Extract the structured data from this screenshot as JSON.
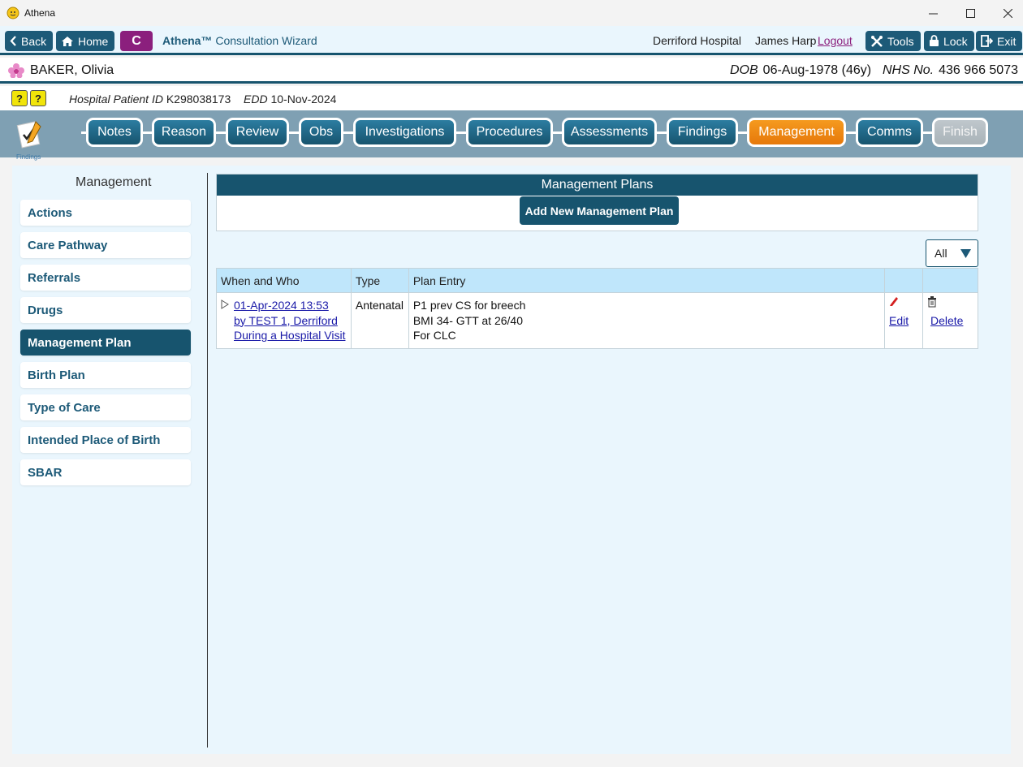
{
  "window": {
    "title": "Athena",
    "minimize": "—",
    "maximize": "☐",
    "close": "✕"
  },
  "topnav": {
    "back_label": "Back",
    "home_label": "Home",
    "c_label": "C",
    "wizard_brand": "Athena™",
    "wizard_title": "Consultation Wizard",
    "hospital": "Derriford Hospital",
    "user": "James Harp",
    "logout": "Logout",
    "tools_label": "Tools",
    "lock_label": "Lock",
    "exit_label": "Exit"
  },
  "patient": {
    "name": "BAKER, Olivia",
    "dob_label": "DOB",
    "dob_value": "06-Aug-1978 (46y)",
    "nhs_label": "NHS No.",
    "nhs_value": "436 966 5073",
    "hospital_id_label": "Hospital Patient ID",
    "hospital_id_value": "K298038173",
    "edd_label": "EDD",
    "edd_value": "10-Nov-2024"
  },
  "steps": {
    "icon_label": "Findings",
    "items": [
      "Notes",
      "Reason",
      "Review",
      "Obs",
      "Investigations",
      "Procedures",
      "Assessments",
      "Findings",
      "Management",
      "Comms",
      "Finish"
    ],
    "active": "Management"
  },
  "sidebar": {
    "title": "Management",
    "items": [
      "Actions",
      "Care Pathway",
      "Referrals",
      "Drugs",
      "Management Plan",
      "Birth Plan",
      "Type of Care",
      "Intended Place of Birth",
      "SBAR"
    ],
    "active": "Management Plan"
  },
  "main": {
    "panel_title": "Management Plans",
    "add_button": "Add New Management Plan",
    "filter_value": "All",
    "table": {
      "headers": [
        "When and Who",
        "Type",
        "Plan Entry",
        "",
        ""
      ],
      "rows": [
        {
          "when_line1": "01-Apr-2024 13:53",
          "when_line2": "by TEST 1, Derriford",
          "when_line3": "During a Hospital Visit",
          "type": "Antenatal",
          "plan_line1": "P1 prev CS for breech",
          "plan_line2": "BMI 34- GTT at 26/40",
          "plan_line3": "For CLC",
          "edit_label": "Edit",
          "delete_label": "Delete"
        }
      ]
    }
  },
  "colors": {
    "primary": "#17546e",
    "accent_active": "#f08a12",
    "c_button": "#8b1f7d",
    "content_bg": "#eaf6fd",
    "table_header": "#bfe6fb",
    "link": "#1a1aa8"
  }
}
